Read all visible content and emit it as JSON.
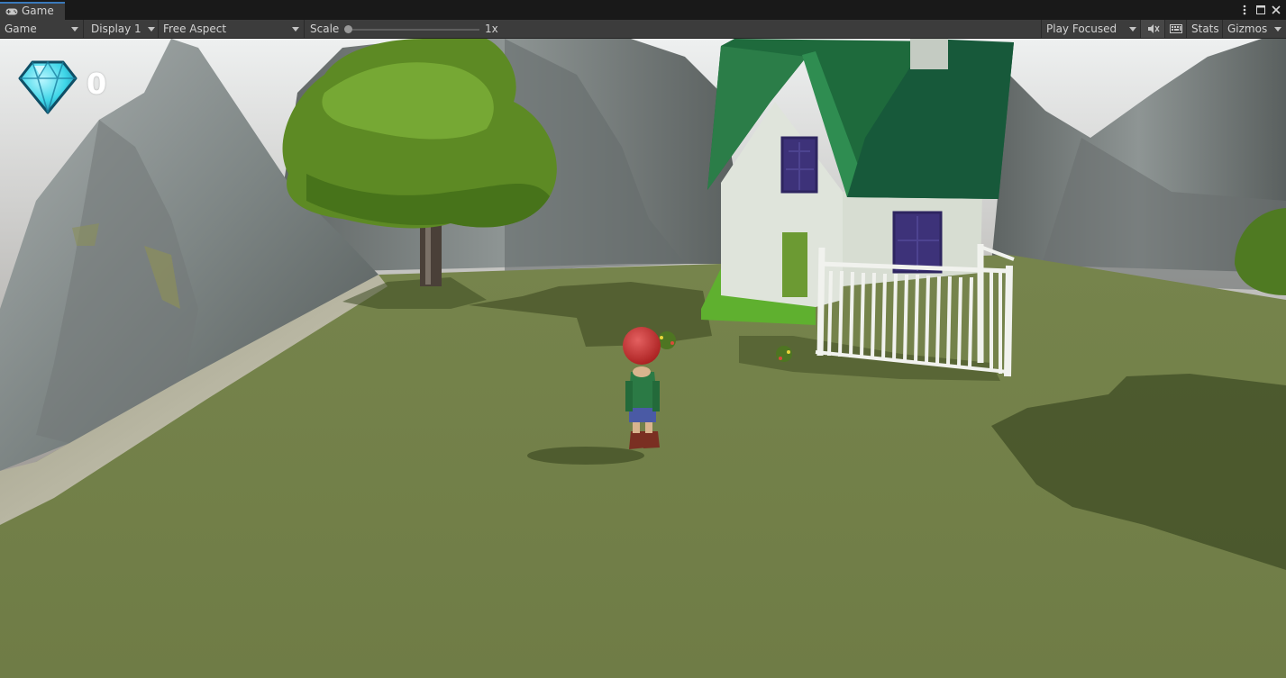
{
  "window": {
    "tab_label": "Game",
    "tab_icon": "gamepad-icon",
    "menu_icon": "vertical-ellipsis-icon",
    "maximize_icon": "maximize-icon",
    "close_icon": "close-icon"
  },
  "toolbar": {
    "mode_selected": "Game",
    "display_selected": "Display 1",
    "aspect_selected": "Free Aspect",
    "scale_label": "Scale",
    "scale_value": "1x",
    "scale_level": 1,
    "play_mode_selected": "Play Focused",
    "mute_icon": "speaker-mute-icon",
    "keyboard_icon": "keyboard-icon",
    "stats_label": "Stats",
    "gizmos_label": "Gizmos"
  },
  "hud": {
    "gem_icon": "diamond-gem-icon",
    "gem_count": "0"
  },
  "colors": {
    "accent_tab": "#3a79bb",
    "toolbar_bg": "#3c3c3c",
    "grass": "#707e48",
    "roof": "#1e6a3c",
    "house_wall": "#dfe4db",
    "window": "#3d3279",
    "door": "#6c9a33",
    "gem": "#3fd6e8",
    "player_hat": "#c42a2a"
  }
}
